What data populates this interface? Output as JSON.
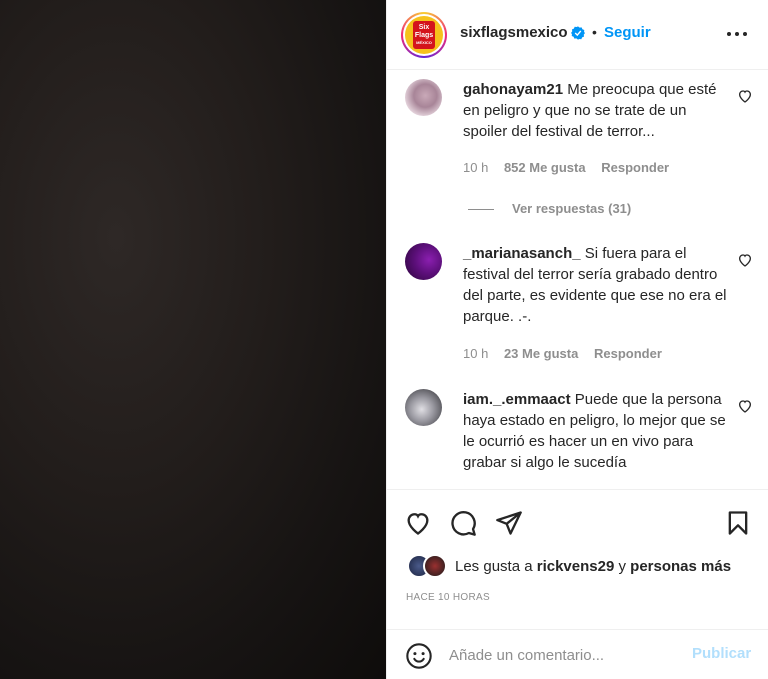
{
  "post": {
    "username": "sixflagsmexico",
    "separator": "•",
    "follow_label": "Seguir",
    "logo_text_line1": "Six",
    "logo_text_line2": "Flags",
    "logo_text_line3": "MÉXICO"
  },
  "comments": [
    {
      "username": "gahonayam21",
      "text": "Me preocupa que esté en peligro y que no se trate de un spoiler del festival de terror...",
      "time": "10 h",
      "likes": "852 Me gusta",
      "reply_label": "Responder",
      "view_replies": "Ver respuestas (31)"
    },
    {
      "username": "_marianasanch_",
      "text": "Si fuera para el festival del terror sería grabado dentro del parte, es evidente que ese no era el parque. .-.",
      "time": "10 h",
      "likes": "23 Me gusta",
      "reply_label": "Responder"
    },
    {
      "username": "iam._.emmaact",
      "text": "Puede que la persona haya estado en peligro, lo mejor que se le ocurrió es hacer un en vivo para grabar si algo le sucedía",
      "time": "",
      "likes": "",
      "reply_label": ""
    }
  ],
  "likes": {
    "prefix": "Les gusta a",
    "user": "rickvens29",
    "connector": "y",
    "others": "personas más"
  },
  "time_ago": "HACE 10 HORAS",
  "comment_box": {
    "placeholder": "Añade un comentario...",
    "publish_label": "Publicar"
  },
  "icons": {
    "verified": "verified-badge-icon",
    "more": "more-options-icon",
    "heart": "heart-icon",
    "comment": "comment-icon",
    "share": "share-icon",
    "save": "bookmark-icon",
    "emoji": "emoji-icon"
  },
  "colors": {
    "accent": "#0095f6",
    "publish_disabled": "#b2dffc",
    "muted": "#8e8e8e",
    "text": "#262626"
  }
}
